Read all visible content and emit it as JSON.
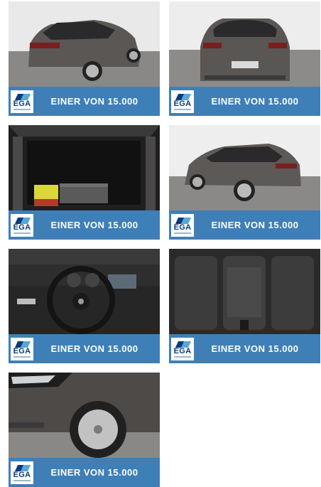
{
  "gallery": {
    "items": [
      {
        "photo": "Car rear-left exterior view",
        "badge": "EGA",
        "tagline": "EINER VON 15.000"
      },
      {
        "photo": "Car rear view",
        "badge": "EGA",
        "tagline": "EINER VON 15.000"
      },
      {
        "photo": "Open trunk with luggage",
        "badge": "EGA",
        "tagline": "EINER VON 15.000"
      },
      {
        "photo": "Car rear-left side view",
        "badge": "EGA",
        "tagline": "EINER VON 15.000"
      },
      {
        "photo": "Dashboard and steering wheel",
        "badge": "EGA",
        "tagline": "EINER VON 15.000"
      },
      {
        "photo": "Rear seats",
        "badge": "EGA",
        "tagline": "EINER VON 15.000"
      },
      {
        "photo": "Front wheel and headlight",
        "badge": "EGA",
        "tagline": "EINER VON 15.000"
      }
    ]
  },
  "colors": {
    "banner": "#3f7fb8",
    "logo_dark": "#0b3a78",
    "logo_light": "#58a6dc"
  }
}
